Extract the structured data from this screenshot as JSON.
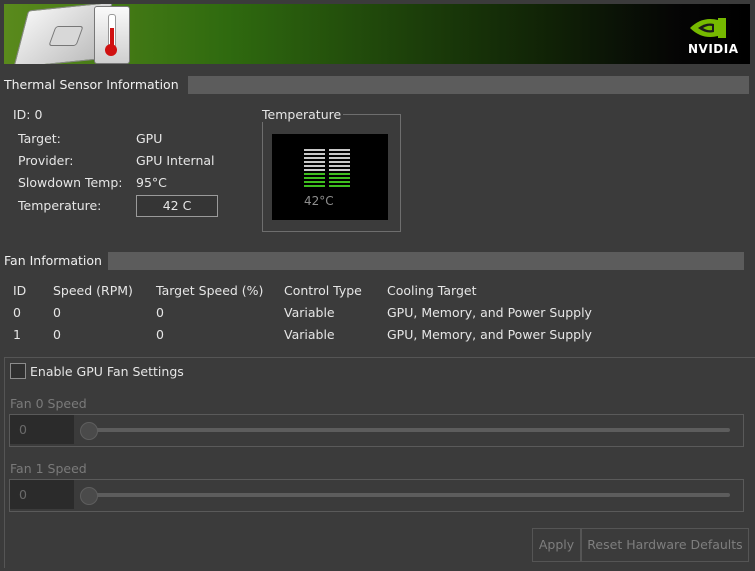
{
  "banner": {
    "brand": "NVIDIA"
  },
  "thermal": {
    "section_title": "Thermal Sensor Information",
    "id_label": "ID: 0",
    "target_label": "Target:",
    "target_value": "GPU",
    "provider_label": "Provider:",
    "provider_value": "GPU Internal",
    "slowdown_label": "Slowdown Temp:",
    "slowdown_value": "95°C",
    "temperature_label": "Temperature:",
    "temperature_value": "42 C",
    "gauge_group_label": "Temperature",
    "gauge_readout": "42°C",
    "gauge_level": 0.4,
    "colors": {
      "gauge_active": "#3fbf1f",
      "gauge_inactive": "#c8c8c8"
    }
  },
  "fan": {
    "section_title": "Fan Information",
    "columns": [
      "ID",
      "Speed (RPM)",
      "Target Speed (%)",
      "Control Type",
      "Cooling Target"
    ],
    "rows": [
      [
        "0",
        "0",
        "0",
        "Variable",
        "GPU, Memory, and Power Supply"
      ],
      [
        "1",
        "0",
        "0",
        "Variable",
        "GPU, Memory, and Power Supply"
      ]
    ]
  },
  "settings": {
    "enable_label": "Enable GPU Fan Settings",
    "enabled": false,
    "fan0_label": "Fan 0 Speed",
    "fan0_value": "0",
    "fan1_label": "Fan 1 Speed",
    "fan1_value": "0",
    "apply_label": "Apply",
    "reset_label": "Reset Hardware Defaults"
  }
}
